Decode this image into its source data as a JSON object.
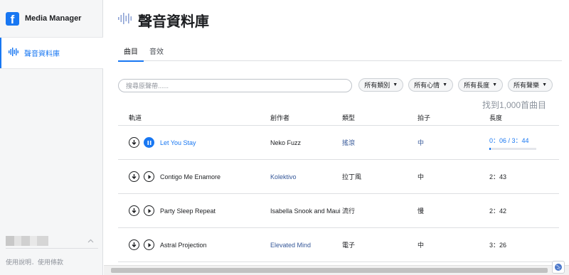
{
  "app": {
    "title": "Media Manager",
    "logo_letter": "f",
    "brand_color": "#1877f2"
  },
  "sidebar": {
    "items": [
      {
        "label": "聲音資料庫",
        "icon": "audio-waveform-icon",
        "active": true
      }
    ],
    "footer": "使用說明．使用條款"
  },
  "header": {
    "title": "聲音資料庫",
    "icon": "audio-waveform-icon"
  },
  "tabs": [
    {
      "label": "曲目",
      "active": true
    },
    {
      "label": "音效",
      "active": false
    }
  ],
  "search": {
    "placeholder": "搜尋原聲帶......",
    "value": ""
  },
  "filters": [
    {
      "label": "所有類別"
    },
    {
      "label": "所有心情"
    },
    {
      "label": "所有長度"
    },
    {
      "label": "所有聲樂"
    }
  ],
  "result_count": "找到1,000首曲目",
  "table": {
    "columns": [
      "軌道",
      "創作者",
      "類型",
      "拍子",
      "長度"
    ],
    "rows": [
      {
        "title": "Let You Stay",
        "artist": "Neko Fuzz",
        "genre": "搖滾",
        "tempo": "中",
        "length": "0：06 / 3：44",
        "playing": true,
        "progress": 0.027
      },
      {
        "title": "Contigo Me Enamore",
        "artist": "Kolektivo",
        "genre": "拉丁風",
        "tempo": "中",
        "length": "2：43",
        "playing": false
      },
      {
        "title": "Party Sleep Repeat",
        "artist": "Isabella Snook and Maui",
        "genre": "流行",
        "tempo": "慢",
        "length": "2：42",
        "playing": false
      },
      {
        "title": "Astral Projection",
        "artist": "Elevated Mind",
        "genre": "電子",
        "tempo": "中",
        "length": "3：26",
        "playing": false
      }
    ]
  }
}
